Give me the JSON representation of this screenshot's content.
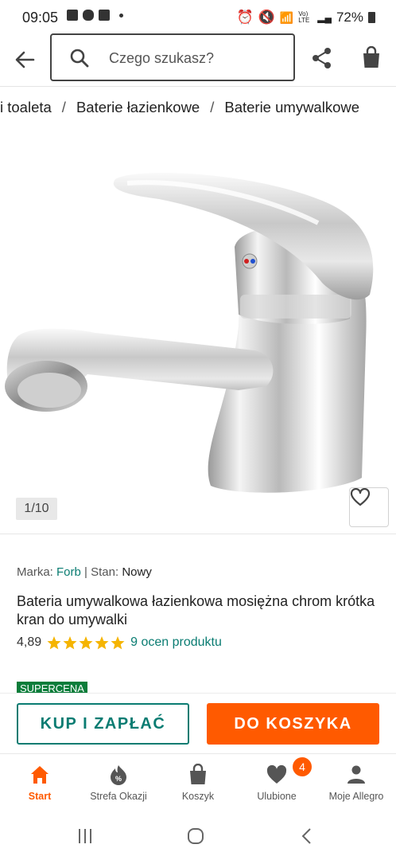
{
  "status_bar": {
    "time": "09:05",
    "network": "Vo) LTE",
    "battery": "72%"
  },
  "header": {
    "search_placeholder": "Czego szukasz?"
  },
  "breadcrumb": {
    "items": [
      "i toaleta",
      "Baterie łazienkowe",
      "Baterie umywalkowe"
    ],
    "separator": "/"
  },
  "gallery": {
    "counter": "1/10"
  },
  "product": {
    "brand_label": "Marka:",
    "brand_value": "Forb",
    "divider": "|",
    "condition_label": "Stan:",
    "condition_value": "Nowy",
    "title": "Bateria umywalkowa łazienkowa mosiężna chrom krótka kran do umywalki",
    "rating_value": "4,89",
    "rating_stars": 5,
    "rating_link": "9 ocen produktu",
    "promo_badge": "SUPERCENA"
  },
  "actions": {
    "buy_now": "KUP I ZAPŁAĆ",
    "add_to_cart": "DO KOSZYKA"
  },
  "bottom_nav": {
    "items": [
      {
        "label": "Start",
        "icon": "home-icon",
        "active": true
      },
      {
        "label": "Strefa Okazji",
        "icon": "deals-icon",
        "active": false
      },
      {
        "label": "Koszyk",
        "icon": "bag-icon",
        "active": false
      },
      {
        "label": "Ulubione",
        "icon": "heart-icon",
        "active": false
      },
      {
        "label": "Moje Allegro",
        "icon": "person-icon",
        "active": false
      }
    ],
    "favorites_badge": "4"
  },
  "colors": {
    "accent": "#ff5a00",
    "teal": "#0a7c72",
    "promo": "#0b7d3a"
  }
}
